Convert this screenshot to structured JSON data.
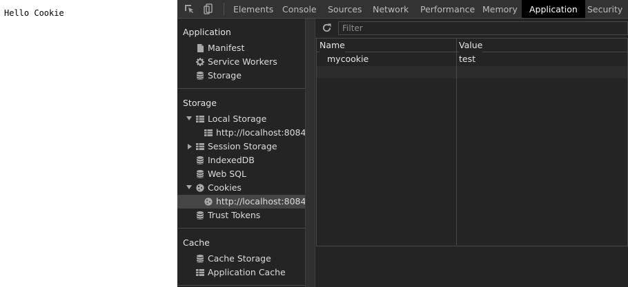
{
  "page": {
    "text": "Hello Cookie"
  },
  "tabs": [
    "Elements",
    "Console",
    "Sources",
    "Network",
    "Performance",
    "Memory",
    "Application",
    "Security"
  ],
  "active_tab": "Application",
  "sidebar": {
    "application": {
      "title": "Application",
      "items": [
        "Manifest",
        "Service Workers",
        "Storage"
      ]
    },
    "storage": {
      "title": "Storage",
      "local_storage": "Local Storage",
      "local_storage_origin": "http://localhost:8084",
      "session_storage": "Session Storage",
      "indexeddb": "IndexedDB",
      "web_sql": "Web SQL",
      "cookies": "Cookies",
      "cookies_origin": "http://localhost:8084",
      "trust_tokens": "Trust Tokens"
    },
    "cache": {
      "title": "Cache",
      "items": [
        "Cache Storage",
        "Application Cache"
      ]
    }
  },
  "main": {
    "filter_placeholder": "Filter",
    "columns": [
      "Name",
      "Value"
    ],
    "rows": [
      {
        "name": "mycookie",
        "value": "test"
      }
    ]
  },
  "colors": {
    "panel_bg": "#242424",
    "tabbar_bg": "#333333",
    "selected_bg": "#454545"
  }
}
